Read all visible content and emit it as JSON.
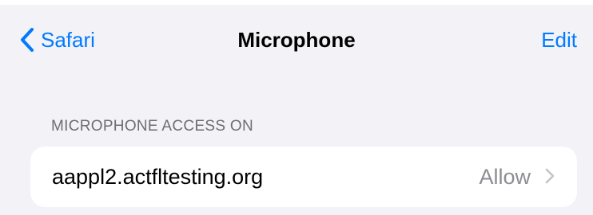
{
  "status_strip": {
    "partial_text_left": "...",
    "partial_text_center": "..."
  },
  "nav": {
    "back_label": "Safari",
    "title": "Microphone",
    "edit_label": "Edit"
  },
  "section": {
    "header": "MICROPHONE ACCESS ON",
    "rows": [
      {
        "site": "aappl2.actfltesting.org",
        "permission": "Allow"
      }
    ]
  },
  "colors": {
    "accent": "#007aff",
    "background": "#f2f2f7",
    "secondary_text": "#8e8e93",
    "section_header": "#6d6d72",
    "chevron": "#c4c4c7"
  },
  "icons": {
    "back": "chevron-left-icon",
    "disclosure": "chevron-right-icon"
  }
}
